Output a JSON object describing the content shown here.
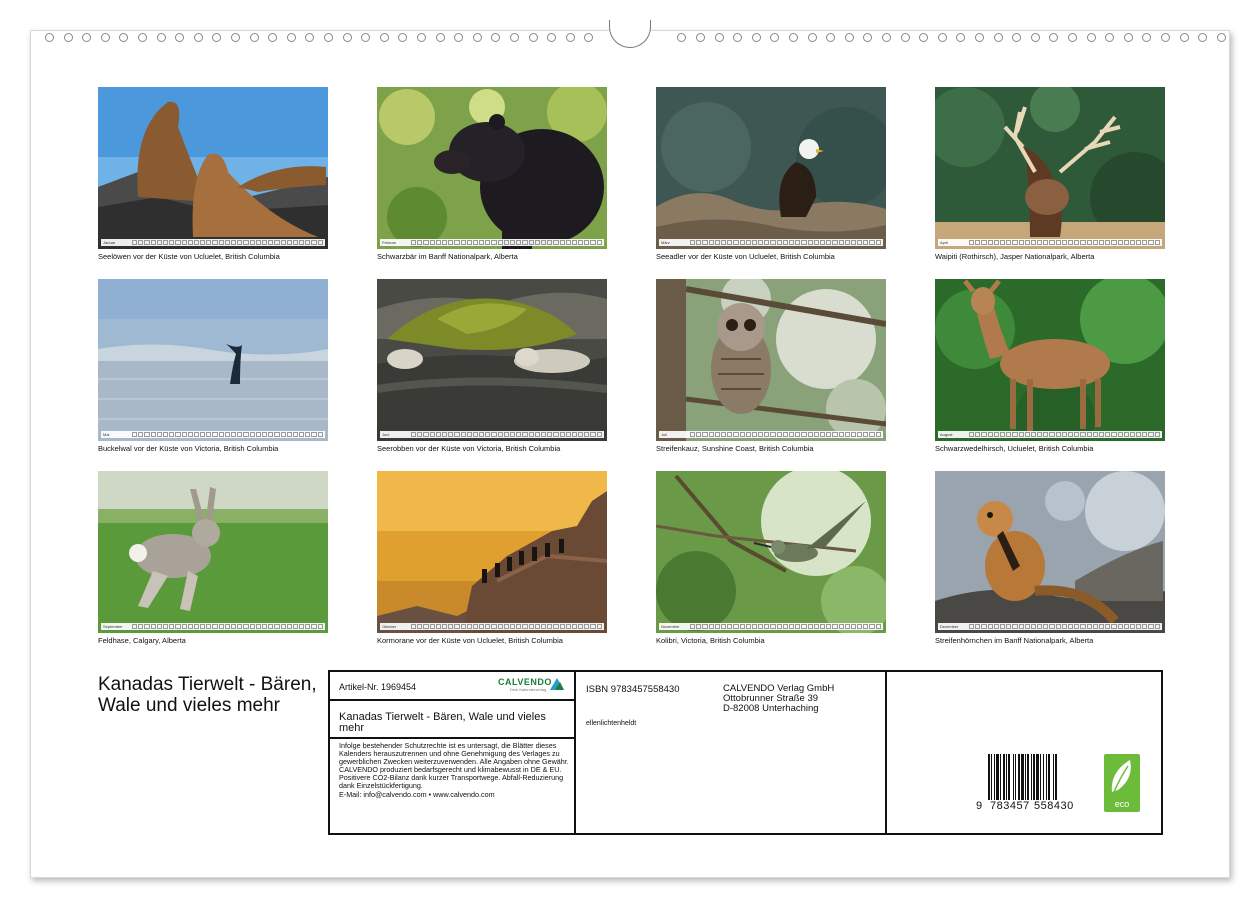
{
  "tiles": [
    {
      "month": "Januar",
      "caption": "Seelöwen vor der Küste von Ucluelet, British Columbia"
    },
    {
      "month": "Februar",
      "caption": "Schwarzbär im Banff Nationalpark, Alberta"
    },
    {
      "month": "März",
      "caption": "Seeadler vor der Küste von Ucluelet, British Columbia"
    },
    {
      "month": "April",
      "caption": "Waipiti (Rothirsch), Jasper Nationalpark, Alberta"
    },
    {
      "month": "Mai",
      "caption": "Buckelwal vor der Küste von Victoria, British Columbia"
    },
    {
      "month": "Juni",
      "caption": "Seerobben vor der Küste von Victoria, British Columbia"
    },
    {
      "month": "Juli",
      "caption": "Streifenkauz, Sunshine Coast, British Columbia"
    },
    {
      "month": "August",
      "caption": "Schwarzwedelhirsch, Ucluelet, British Columbia"
    },
    {
      "month": "September",
      "caption": "Feldhase, Calgary, Alberta"
    },
    {
      "month": "Oktober",
      "caption": "Kormorane vor der Küste von Ucluelet, British Columbia"
    },
    {
      "month": "November",
      "caption": "Kolibri, Victoria, British Columbia"
    },
    {
      "month": "Dezember",
      "caption": "Streifenhörnchen im Banff Nationalpark, Alberta"
    }
  ],
  "title": "Kanadas Tierwelt - Bären, Wale und vieles mehr",
  "info": {
    "article": "Artikel-Nr. 1969454",
    "logo": "CALVENDO",
    "logo_sub": "Dein Kalenderverlag",
    "product_title": "Kanadas Tierwelt - Bären, Wale und vieles mehr",
    "legal_1": "Infolge bestehender Schutzrechte ist es untersagt, die Blätter dieses Kalenders herauszutrennen und ohne Genehmigung des Verlages zu gewerblichen Zwecken weiterzuverwenden. Alle Angaben ohne Gewähr.",
    "legal_2": "CALVENDO produziert bedarfsgerecht und klimabewusst in DE & EU. Positivere CO2-Bilanz dank kurzer Transportwege. Abfall-Reduzierung dank Einzelstückfertigung.",
    "legal_3": "E-Mail: info@calvendo.com • www.calvendo.com",
    "isbn": "ISBN 9783457558430",
    "author": "ellenlichtenheldt",
    "publisher_1": "CALVENDO Verlag GmbH",
    "publisher_2": "Ottobrunner Straße 39",
    "publisher_3": "D-82008 Unterhaching",
    "barcode_lead": "9",
    "barcode_left": "783457",
    "barcode_right": "558430",
    "eco_label": "eco"
  }
}
